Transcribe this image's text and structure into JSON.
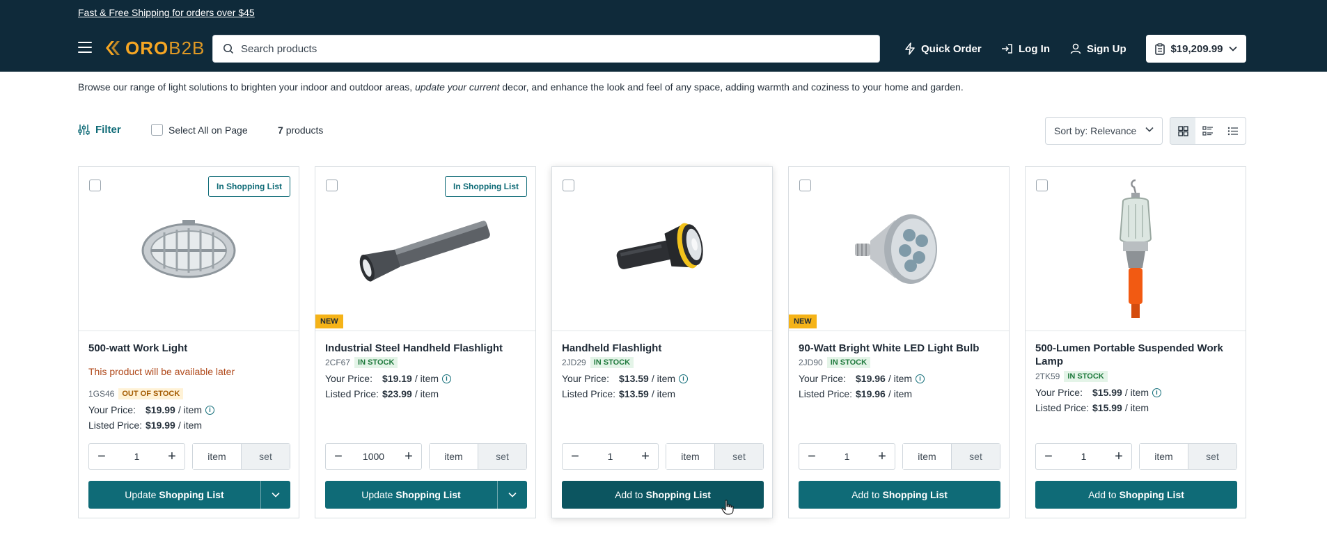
{
  "header": {
    "promo": "Fast & Free Shipping for orders over $45",
    "logo_oro": "ORO",
    "logo_b2b": "B2B",
    "search_placeholder": "Search products",
    "quick_order": "Quick Order",
    "log_in": "Log In",
    "sign_up": "Sign Up",
    "cart_total": "$19,209.99"
  },
  "intro": {
    "part1": "Browse our range of light solutions to brighten your indoor and outdoor areas, ",
    "italic": "update your current",
    "part2": " decor, and enhance the look and feel of any space, adding warmth and coziness to your home and garden."
  },
  "toolbar": {
    "filter": "Filter",
    "select_all": "Select All on Page",
    "count_num": "7",
    "count_label": "products",
    "sort_label": "Sort by:",
    "sort_value": "Relevance"
  },
  "labels": {
    "your_price": "Your Price:",
    "listed_price": "Listed Price:",
    "per_item": "/ item",
    "unit_item": "item",
    "unit_set": "set",
    "in_list": "In Shopping List",
    "new": "NEW",
    "action_add": "Add to",
    "action_update": "Update",
    "action_target": "Shopping List"
  },
  "products": [
    {
      "name": "500-watt Work Light",
      "availability_note": "This product will be available later",
      "sku": "1GS46",
      "stock": "OUT OF STOCK",
      "your_price": "$19.99",
      "listed_price": "$19.99",
      "qty": "1"
    },
    {
      "name": "Industrial Steel Handheld Flashlight",
      "sku": "2CF67",
      "stock": "IN STOCK",
      "your_price": "$19.19",
      "listed_price": "$23.99",
      "qty": "1000"
    },
    {
      "name": "Handheld Flashlight",
      "sku": "2JD29",
      "stock": "IN STOCK",
      "your_price": "$13.59",
      "listed_price": "$13.59",
      "qty": "1"
    },
    {
      "name": "90-Watt Bright White LED Light Bulb",
      "sku": "2JD90",
      "stock": "IN STOCK",
      "your_price": "$19.96",
      "listed_price": "$19.96",
      "qty": "1"
    },
    {
      "name": "500-Lumen Portable Suspended Work Lamp",
      "sku": "2TK59",
      "stock": "IN STOCK",
      "your_price": "$15.99",
      "listed_price": "$15.99",
      "qty": "1"
    }
  ],
  "colors": {
    "header_bg": "#0f2a3a",
    "accent": "#0f6b77",
    "brand": "#f6a623",
    "new_badge": "#f5b318"
  }
}
